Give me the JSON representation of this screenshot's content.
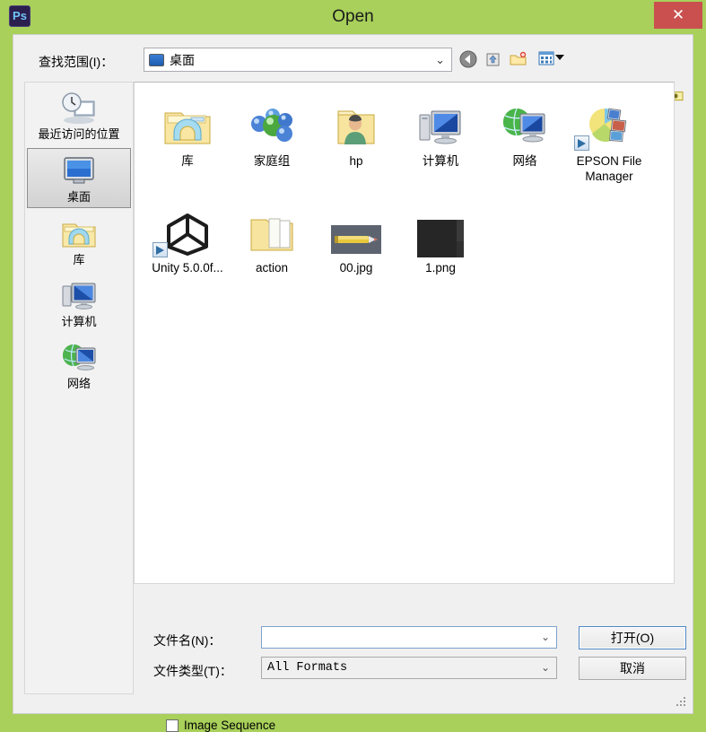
{
  "window": {
    "title": "Open",
    "app_icon": "photoshop-icon",
    "app_icon_text": "Ps",
    "close_label": "✕",
    "titlebar_color": "#a8d05a",
    "close_button_color": "#c9504f"
  },
  "lookin": {
    "label": "查找范围(I)：",
    "value": "桌面",
    "chevron": "⌄"
  },
  "toolbar": {
    "items": [
      {
        "name": "back-icon",
        "title": "后退"
      },
      {
        "name": "up-folder-icon",
        "title": "向上"
      },
      {
        "name": "new-folder-icon",
        "title": "新建文件夹"
      },
      {
        "name": "views-icon",
        "title": "视图"
      }
    ],
    "right_icon": "options-folder-icon"
  },
  "places": {
    "items": [
      {
        "label": "最近访问的位置",
        "icon": "recent-places-icon",
        "selected": false
      },
      {
        "label": "桌面",
        "icon": "desktop-icon",
        "selected": true
      },
      {
        "label": "库",
        "icon": "libraries-icon",
        "selected": false
      },
      {
        "label": "计算机",
        "icon": "computer-icon",
        "selected": false
      },
      {
        "label": "网络",
        "icon": "network-icon",
        "selected": false
      }
    ]
  },
  "files": {
    "items": [
      {
        "name": "库",
        "icon": "library-folder-icon",
        "shortcut": false
      },
      {
        "name": "家庭组",
        "icon": "homegroup-icon",
        "shortcut": false
      },
      {
        "name": "hp",
        "icon": "user-folder-icon",
        "shortcut": false
      },
      {
        "name": "计算机",
        "icon": "computer-icon",
        "shortcut": false
      },
      {
        "name": "网络",
        "icon": "network-icon",
        "shortcut": false
      },
      {
        "name": "EPSON File Manager",
        "icon": "epson-file-manager-icon",
        "shortcut": true
      },
      {
        "name": "Unity 5.0.0f...",
        "icon": "unity-icon",
        "shortcut": true
      },
      {
        "name": "action",
        "icon": "folder-icon",
        "shortcut": false
      },
      {
        "name": "00.jpg",
        "icon": "image-thumbnail-pencil",
        "shortcut": false
      },
      {
        "name": "1.png",
        "icon": "image-thumbnail-dark",
        "shortcut": false
      }
    ]
  },
  "fields": {
    "filename_label": "文件名(N)：",
    "filename_value": "",
    "filetype_label": "文件类型(T)：",
    "filetype_value": "All Formats",
    "chevron": "⌄"
  },
  "buttons": {
    "open": "打开(O)",
    "cancel": "取消"
  },
  "options": {
    "image_sequence_label": "Image Sequence",
    "image_sequence_checked": false
  }
}
